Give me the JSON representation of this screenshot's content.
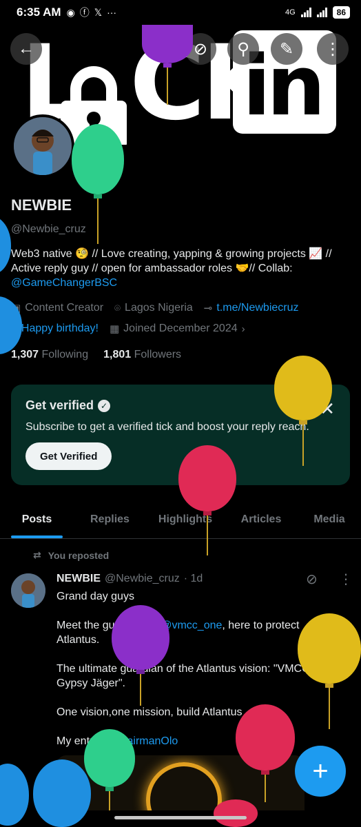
{
  "status_bar": {
    "time": "6:35 AM",
    "network": "4G",
    "battery": "86"
  },
  "banner": {
    "word_left": "L",
    "word_mid": "CK",
    "word_right": "in"
  },
  "profile": {
    "name": "NEWBIE",
    "handle": "@Newbie_cruz",
    "bio_text": "Web3 native 🧐 // Love creating, yapping & growing projects 📈 // Active reply guy  // open for ambassador roles 🤝// Collab: ",
    "bio_link": "@GameChangerBSC",
    "category": "Content Creator",
    "location": "Lagos Nigeria",
    "website": "t.me/Newbiecruz",
    "birthday": "Happy birthday!",
    "joined": "Joined December 2024",
    "following_count": "1,307",
    "following_label": "Following",
    "followers_count": "1,801",
    "followers_label": "Followers"
  },
  "verify_card": {
    "title": "Get verified",
    "subtitle": "Subscribe to get a verified tick and boost your reply reach.",
    "button": "Get Verified"
  },
  "tabs": [
    "Posts",
    "Replies",
    "Highlights",
    "Articles",
    "Media"
  ],
  "post": {
    "repost_label": "You reposted",
    "author": "NEWBIE",
    "handle": "@Newbie_cruz",
    "time": "· 1d",
    "line1": "Grand day guys",
    "line2_a": "Meet the guardian of ",
    "line2_link": "@vmcc_one",
    "line2_b": ", here to protect Atlantus.",
    "line3": "The ultimate guardian of the Atlantus vision: \"VMCC One Gypsy Jäger\".",
    "line4": "One vision,one mission, build Atlantus",
    "line5_a": "My entry ",
    "line5_link": "@ChairmanOlo"
  },
  "colors": {
    "accent": "#1d9bf0",
    "background": "#000000",
    "card": "#062e26",
    "muted": "#71767b"
  },
  "icons": {
    "back": "arrow-left-icon",
    "grok": "grok-icon",
    "search": "search-icon",
    "edit": "edit-icon",
    "more": "more-vertical-icon",
    "fab": "plus-icon"
  }
}
